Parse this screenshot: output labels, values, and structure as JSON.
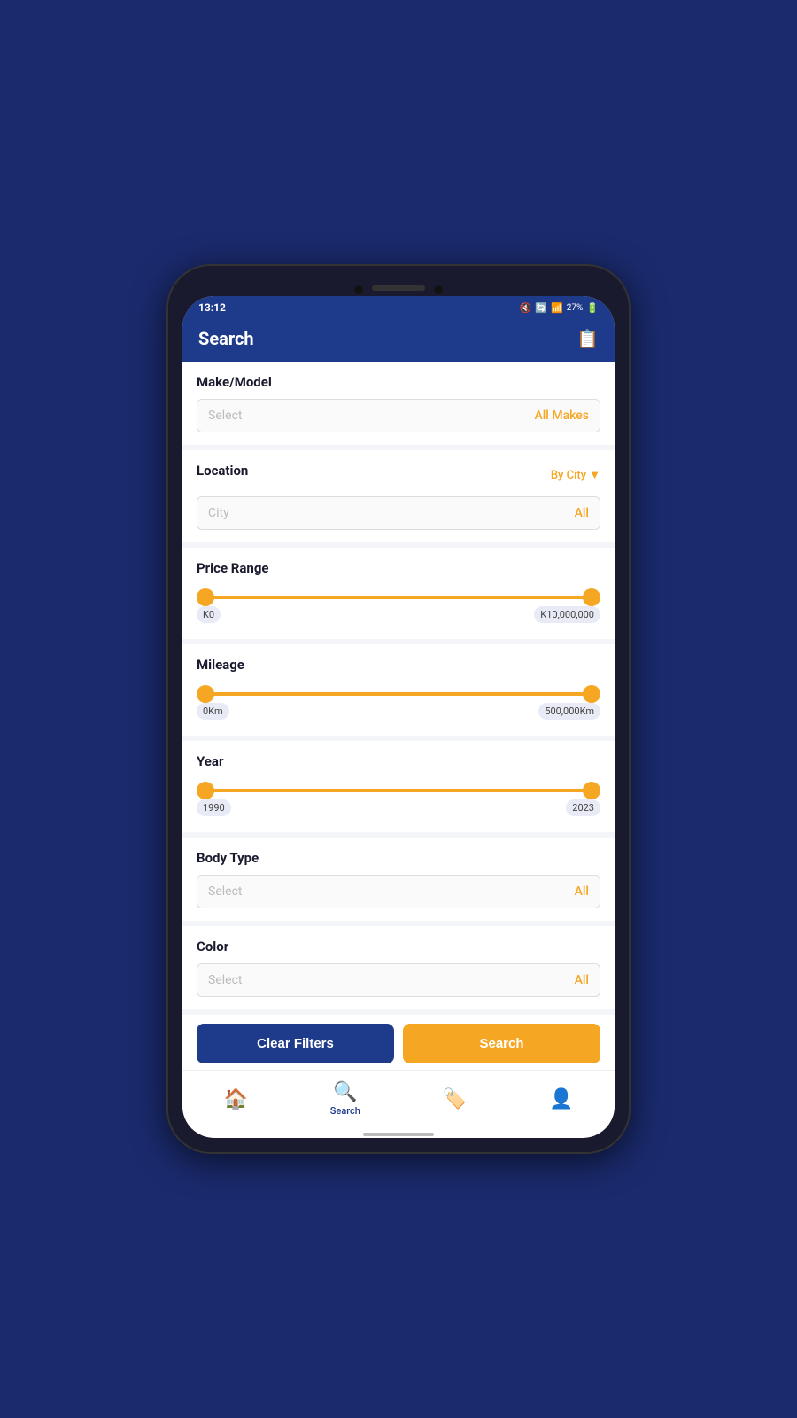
{
  "statusBar": {
    "time": "13:12",
    "battery": "27%",
    "signal": "signal"
  },
  "header": {
    "title": "Search",
    "iconLabel": "filter-icon"
  },
  "sections": {
    "makeModel": {
      "label": "Make/Model",
      "placeholder": "Select",
      "value": "All Makes"
    },
    "location": {
      "label": "Location",
      "byCity": "By City",
      "placeholder": "City",
      "value": "All"
    },
    "priceRange": {
      "label": "Price Range",
      "min": "K0",
      "max": "K10,000,000"
    },
    "mileage": {
      "label": "Mileage",
      "min": "0Km",
      "max": "500,000Km"
    },
    "year": {
      "label": "Year",
      "min": "1990",
      "max": "2023"
    },
    "bodyType": {
      "label": "Body Type",
      "placeholder": "Select",
      "value": "All"
    },
    "color": {
      "label": "Color",
      "placeholder": "Select",
      "value": "All"
    }
  },
  "buttons": {
    "clearFilters": "Clear Filters",
    "search": "Search"
  },
  "nav": {
    "home": "home",
    "search": "Search",
    "tags": "tags",
    "profile": "profile"
  }
}
